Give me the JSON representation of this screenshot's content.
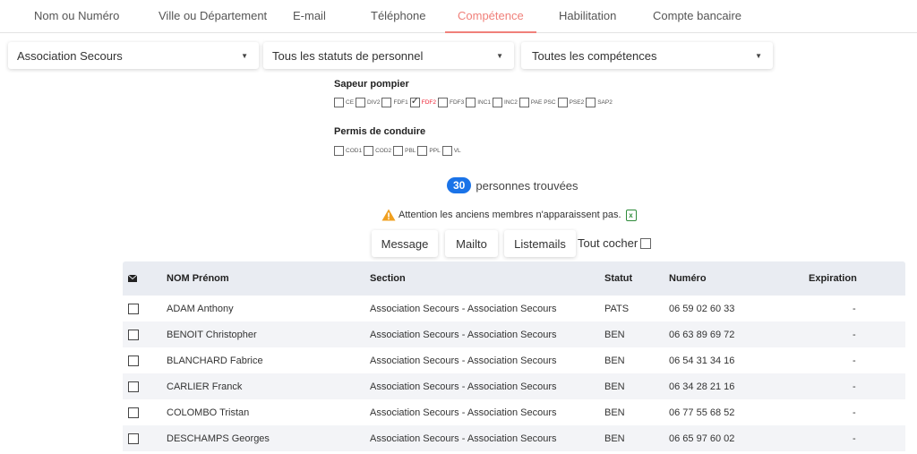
{
  "tabs": [
    {
      "label": "Nom ou Numéro",
      "active": false
    },
    {
      "label": "Ville ou Département",
      "active": false
    },
    {
      "label": "E-mail",
      "active": false
    },
    {
      "label": "Téléphone",
      "active": false
    },
    {
      "label": "Compétence",
      "active": true
    },
    {
      "label": "Habilitation",
      "active": false
    },
    {
      "label": "Compte bancaire",
      "active": false
    }
  ],
  "filters": {
    "section": "Association Secours",
    "statut": "Tous les statuts de personnel",
    "competence": "Toutes les compétences"
  },
  "groups": [
    {
      "title": "Sapeur pompier",
      "items": [
        {
          "label": "CE",
          "checked": false
        },
        {
          "label": "DIV2",
          "checked": false
        },
        {
          "label": "FDF1",
          "checked": false
        },
        {
          "label": "FDF2",
          "checked": true
        },
        {
          "label": "FDF3",
          "checked": false
        },
        {
          "label": "INC1",
          "checked": false
        },
        {
          "label": "INC2",
          "checked": false
        },
        {
          "label": "PAE PSC",
          "checked": false
        },
        {
          "label": "PSE2",
          "checked": false
        },
        {
          "label": "SAP2",
          "checked": false
        }
      ]
    },
    {
      "title": "Permis de conduire",
      "items": [
        {
          "label": "COD1",
          "checked": false
        },
        {
          "label": "COD2",
          "checked": false
        },
        {
          "label": "PBL",
          "checked": false
        },
        {
          "label": "PPL",
          "checked": false
        },
        {
          "label": "VL",
          "checked": false
        }
      ]
    }
  ],
  "results": {
    "count": "30",
    "label": "personnes trouvées"
  },
  "warning": "Attention les anciens membres n'apparaissent pas.",
  "actions": {
    "message": "Message",
    "mailto": "Mailto",
    "listemails": "Listemails",
    "tout_cocher": "Tout cocher"
  },
  "table": {
    "headers": [
      "NOM Prénom",
      "Section",
      "Statut",
      "Numéro",
      "Expiration"
    ],
    "rows": [
      [
        "ADAM Anthony",
        "Association Secours - Association Secours",
        "PATS",
        "06 59 02 60 33",
        "-"
      ],
      [
        "BENOIT Christopher",
        "Association Secours - Association Secours",
        "BEN",
        "06 63 89 69 72",
        "-"
      ],
      [
        "BLANCHARD Fabrice",
        "Association Secours - Association Secours",
        "BEN",
        "06 54 31 34 16",
        "-"
      ],
      [
        "CARLIER Franck",
        "Association Secours - Association Secours",
        "BEN",
        "06 34 28 21 16",
        "-"
      ],
      [
        "COLOMBO Tristan",
        "Association Secours - Association Secours",
        "BEN",
        "06 77 55 68 52",
        "-"
      ],
      [
        "DESCHAMPS Georges",
        "Association Secours - Association Secours",
        "BEN",
        "06 65 97 60 02",
        "-"
      ]
    ]
  },
  "colors": {
    "active_tab": "#f0807a",
    "badge": "#1a73e8",
    "header_bg": "#e9ecf2"
  },
  "icons": [
    "envelope-icon",
    "warning-icon",
    "excel-icon",
    "caret-down-icon"
  ]
}
